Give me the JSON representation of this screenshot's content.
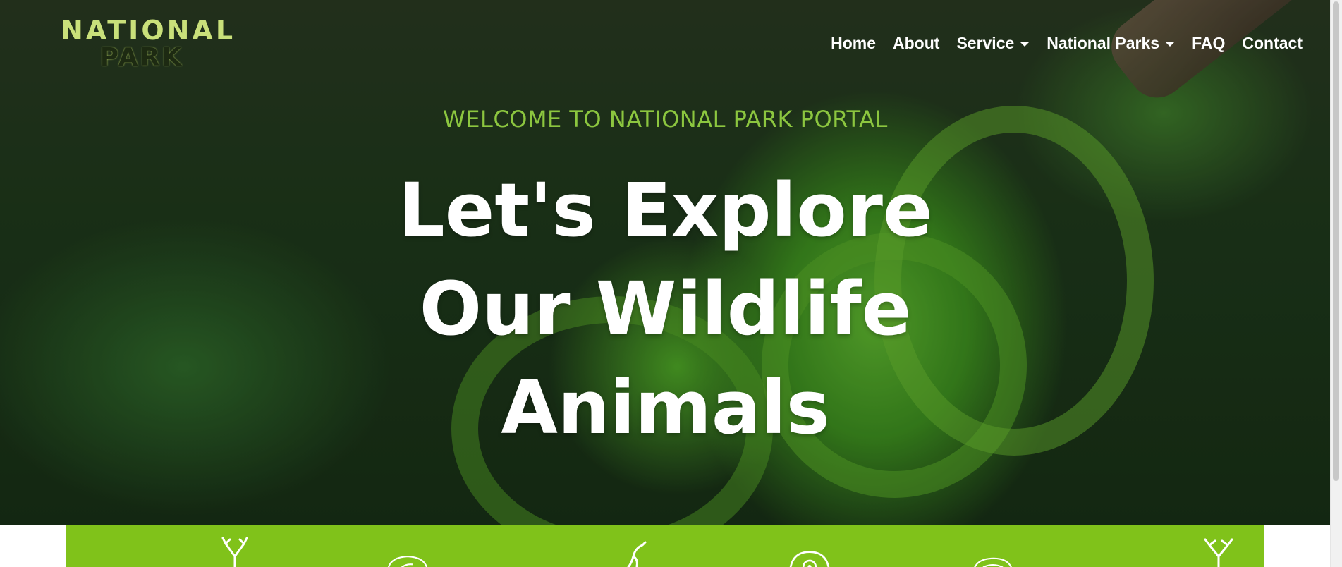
{
  "logo": {
    "line1": "NATIONAL",
    "line2": "PARK"
  },
  "nav": {
    "items": [
      {
        "label": "Home",
        "dropdown": false
      },
      {
        "label": "About",
        "dropdown": false
      },
      {
        "label": "Service",
        "dropdown": true
      },
      {
        "label": "National Parks",
        "dropdown": true
      },
      {
        "label": "FAQ",
        "dropdown": false
      },
      {
        "label": "Contact",
        "dropdown": false
      }
    ]
  },
  "hero": {
    "welcome": "WELCOME TO NATIONAL PARK PORTAL",
    "headline_lines": [
      "Let's Explore",
      "Our Wildlife",
      "Animals"
    ]
  },
  "feature_bar": {
    "color": "#80c21a",
    "icons": [
      "deer-icon",
      "turtle-icon",
      "bird-icon",
      "snail-icon",
      "fish-icon",
      "antlers-icon"
    ]
  },
  "colors": {
    "accent": "#8cc63f",
    "nav_text": "#ffffff"
  }
}
